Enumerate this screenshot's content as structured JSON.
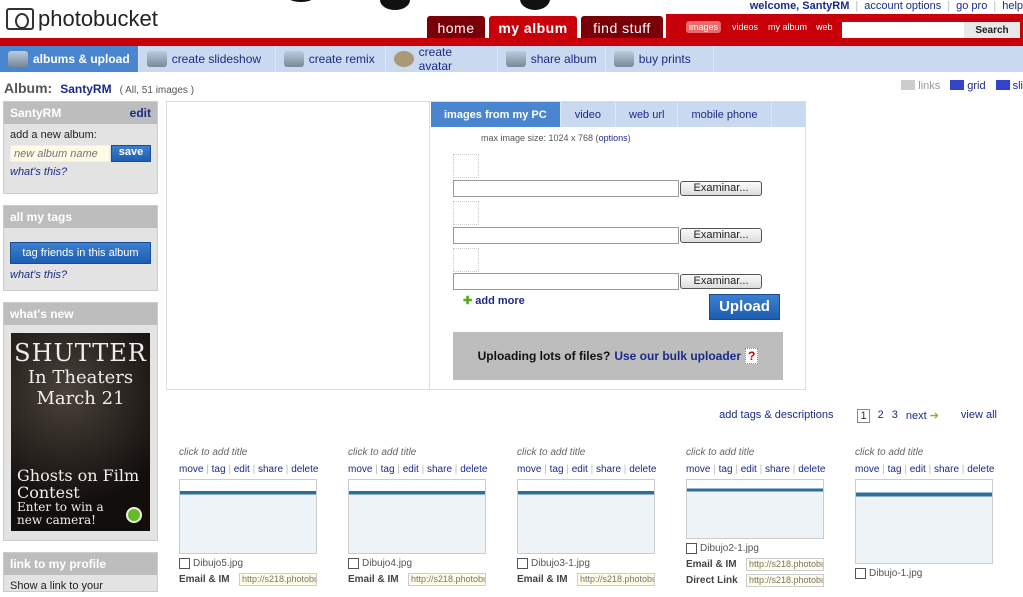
{
  "header": {
    "logo": "photobucket",
    "welcome": "welcome, SantyRM",
    "links": [
      "account options",
      "go pro",
      "help"
    ],
    "tabs": [
      "home",
      "my album",
      "find stuff"
    ],
    "search": {
      "options": [
        "images",
        "videos",
        "my album",
        "web"
      ],
      "selected": "images",
      "value": "",
      "button": "Search"
    }
  },
  "subnav": [
    "albums & upload",
    "create slideshow",
    "create remix",
    "create avatar",
    "share album",
    "buy prints"
  ],
  "album": {
    "label": "Album:",
    "name": "SantyRM",
    "count": "( All, 51 images )"
  },
  "views": [
    "links",
    "grid",
    "sli"
  ],
  "sidebar": {
    "album_box": {
      "title": "SantyRM",
      "edit": "edit",
      "add_label": "add a new album:",
      "placeholder": "new album name",
      "save": "save",
      "whats_this": "what's this?"
    },
    "tags_box": {
      "title": "all my tags",
      "button": "tag friends in this album",
      "whats_this": "what's this?"
    },
    "news_box": {
      "title": "what's new",
      "ad": {
        "line1": "SHUTTER",
        "line2": "In Theaters",
        "line3": "March 21",
        "line4": "Ghosts on Film",
        "line5": "Contest",
        "line6": "Enter to win a",
        "line7": "new camera!"
      }
    },
    "profile_box": {
      "title": "link to my profile",
      "text": "Show a link to your"
    }
  },
  "upload": {
    "tabs": [
      "images from my PC",
      "video",
      "web url",
      "mobile phone"
    ],
    "active": "images from my PC",
    "max_size": "max image size: 1024 x 768 (",
    "options": "options",
    "max_close": ")",
    "browse": "Examinar...",
    "add_more": "add more",
    "upload": "Upload",
    "bulk_q": "Uploading lots of files?",
    "bulk_link": "Use our bulk uploader",
    "help": "?"
  },
  "pager": {
    "add_tags": "add tags & descriptions",
    "pages": [
      "1",
      "2",
      "3"
    ],
    "current": "1",
    "next": "next",
    "view_all": "view all"
  },
  "thumbs": [
    {
      "title": "click to add title",
      "file": "Dibujo5.jpg",
      "links": [
        {
          "label": "Email & IM",
          "value": "http://s218.photobu"
        }
      ]
    },
    {
      "title": "click to add title",
      "file": "Dibujo4.jpg",
      "links": [
        {
          "label": "Email & IM",
          "value": "http://s218.photobu"
        }
      ]
    },
    {
      "title": "click to add title",
      "file": "Dibujo3-1.jpg",
      "links": [
        {
          "label": "Email & IM",
          "value": "http://s218.photobu"
        }
      ]
    },
    {
      "title": "click to add title",
      "file": "Dibujo2-1.jpg",
      "links": [
        {
          "label": "Email & IM",
          "value": "http://s218.photobu"
        },
        {
          "label": "Direct Link",
          "value": "http://s218.photobu"
        }
      ]
    },
    {
      "title": "click to add title",
      "file": "Dibujo-1.jpg",
      "links": []
    }
  ],
  "thumb_actions": [
    "move",
    "tag",
    "edit",
    "share",
    "delete"
  ],
  "colors": {
    "red": "#c8000a",
    "darkred": "#7a0008",
    "navblue": "#c9d9ef",
    "activeblue": "#4a86d0",
    "link": "#1b2a8a"
  }
}
